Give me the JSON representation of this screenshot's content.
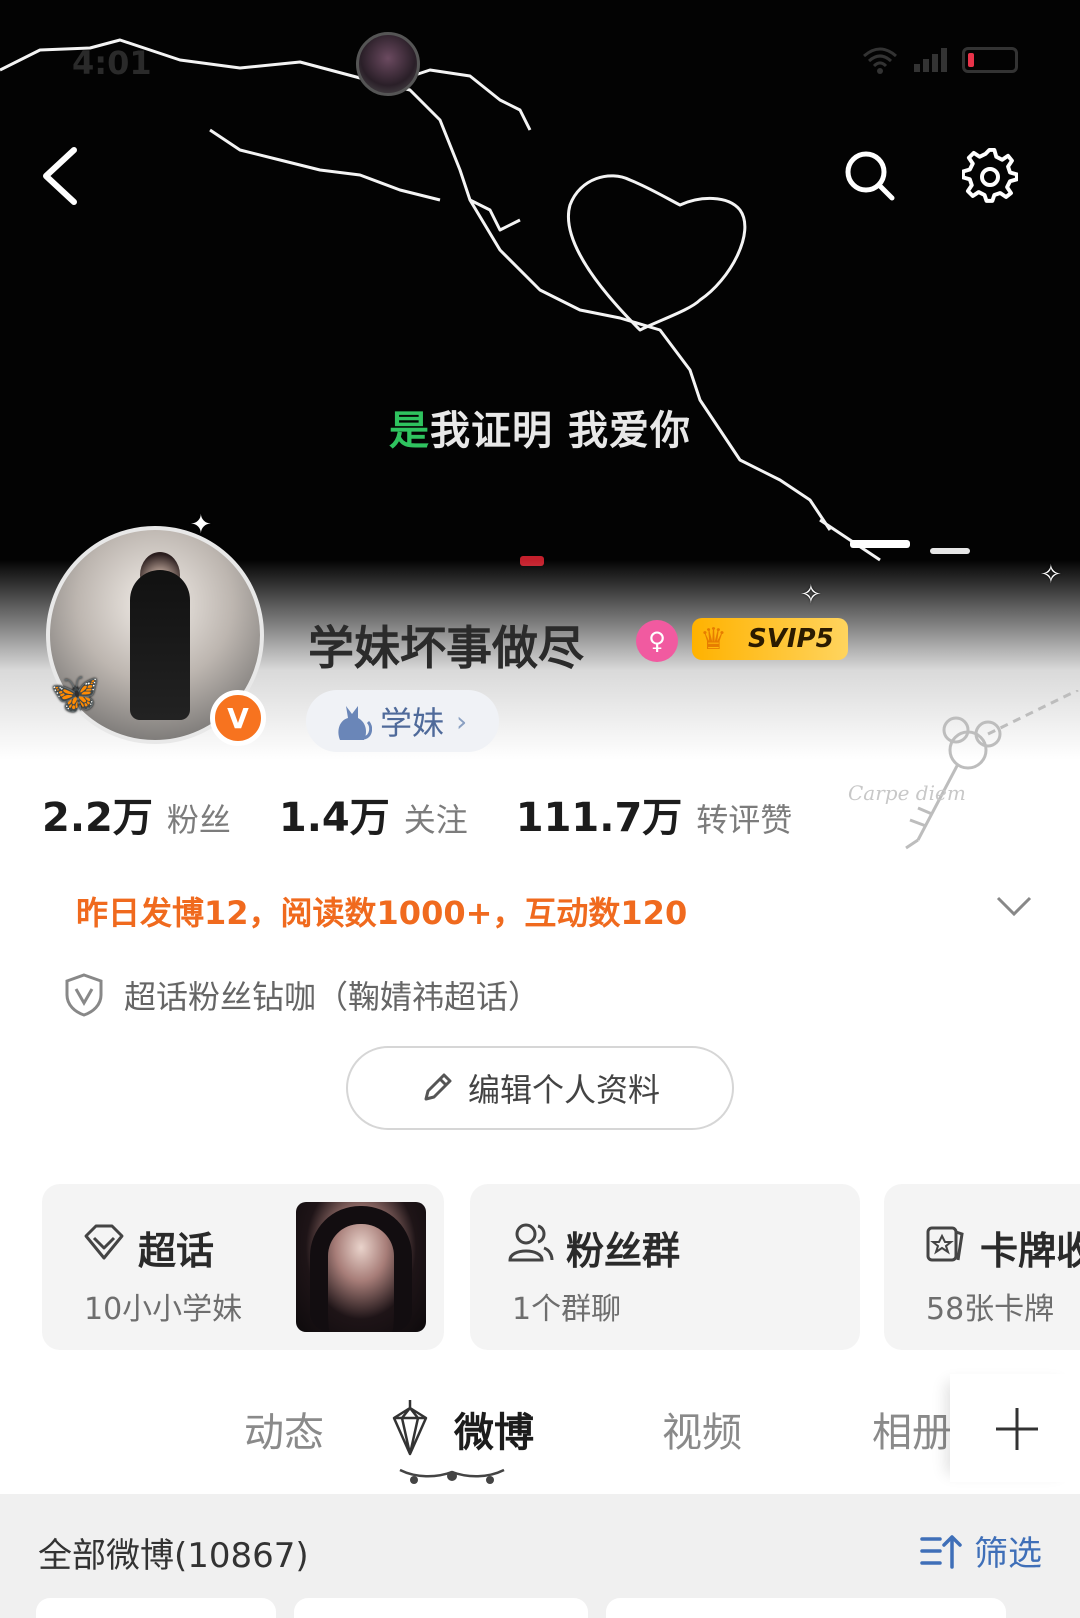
{
  "status_bar": {
    "time": "4:01"
  },
  "banner": {
    "lyric_highlight": "是",
    "lyric_rest": "我证明 我爱你"
  },
  "profile": {
    "username": "学妹坏事做尽",
    "verified_badge": "V",
    "gender_icon": "female-icon",
    "svip_label": "SVIP5",
    "tag_label": "学妹",
    "deco_signature": "Carpe diem"
  },
  "stats": [
    {
      "value": "2.2万",
      "label": "粉丝"
    },
    {
      "value": "1.4万",
      "label": "关注"
    },
    {
      "value": "111.7万",
      "label": "转评赞"
    }
  ],
  "activity_text": "昨日发博12，阅读数1000+，互动数120",
  "fan_badge_text": "超话粉丝钻咖（鞠婧祎超话）",
  "edit_button_label": "编辑个人资料",
  "cards": [
    {
      "title": "超话",
      "subtitle": "10小小学妹",
      "icon": "diamond-icon"
    },
    {
      "title": "粉丝群",
      "subtitle": "1个群聊",
      "icon": "group-icon"
    },
    {
      "title": "卡牌收",
      "subtitle": "58张卡牌",
      "icon": "card-icon"
    }
  ],
  "tabs": [
    {
      "label": "动态",
      "active": false
    },
    {
      "label": "微博",
      "active": true
    },
    {
      "label": "视频",
      "active": false
    },
    {
      "label": "相册",
      "active": false
    }
  ],
  "filter": {
    "title": "全部微博(10867)",
    "button_label": "筛选"
  },
  "colors": {
    "accent_orange": "#f06a1e",
    "vip_gold": "#ffb200",
    "link_blue": "#3f6fb8",
    "gender_pink": "#f15aa0"
  }
}
